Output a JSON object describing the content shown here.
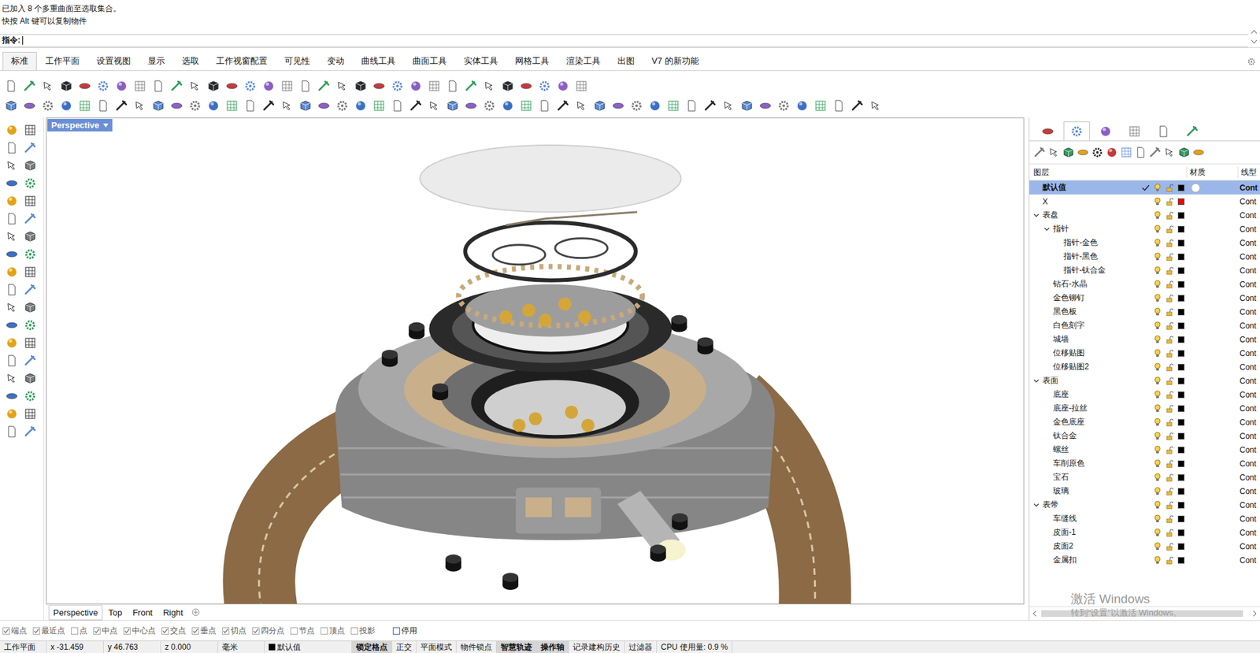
{
  "command": {
    "history": [
      "已加入 8 个多重曲面至选取集合。",
      "快按 Alt 键可以复制物件"
    ],
    "prompt": "指令:"
  },
  "menu_tabs": [
    {
      "label": "标准",
      "selected": true
    },
    {
      "label": "工作平面",
      "selected": false
    },
    {
      "label": "设置视图",
      "selected": false
    },
    {
      "label": "显示",
      "selected": false
    },
    {
      "label": "选取",
      "selected": false
    },
    {
      "label": "工作视窗配置",
      "selected": false
    },
    {
      "label": "可见性",
      "selected": false
    },
    {
      "label": "变动",
      "selected": false
    },
    {
      "label": "曲线工具",
      "selected": false
    },
    {
      "label": "曲面工具",
      "selected": false
    },
    {
      "label": "实体工具",
      "selected": false
    },
    {
      "label": "网格工具",
      "selected": false
    },
    {
      "label": "渲染工具",
      "selected": false
    },
    {
      "label": "出图",
      "selected": false
    },
    {
      "label": "V7 的新功能",
      "selected": false
    }
  ],
  "viewport": {
    "title": "Perspective"
  },
  "viewport_tabs": [
    {
      "label": "Perspective",
      "selected": true
    },
    {
      "label": "Top",
      "selected": false
    },
    {
      "label": "Front",
      "selected": false
    },
    {
      "label": "Right",
      "selected": false
    }
  ],
  "panel_tabs": [
    {
      "selected": false
    },
    {
      "selected": true
    },
    {
      "selected": false
    },
    {
      "selected": false
    },
    {
      "selected": false
    },
    {
      "selected": false
    }
  ],
  "layer_panel": {
    "columns": [
      "图层",
      "材质",
      "线型"
    ],
    "layers": [
      {
        "name": "默认值",
        "depth": 0,
        "kind": "layer",
        "expanded": false,
        "selected": true,
        "current": true,
        "visible": true,
        "locked": false,
        "color": "#000000",
        "material_swatch": true,
        "linetype": "Cont"
      },
      {
        "name": "X",
        "depth": 0,
        "kind": "layer",
        "expanded": false,
        "selected": false,
        "current": false,
        "visible": true,
        "locked": false,
        "color": "#ff0000",
        "material_swatch": false,
        "linetype": "Cont"
      },
      {
        "name": "表盘",
        "depth": 0,
        "kind": "group",
        "expanded": true,
        "selected": false,
        "current": false,
        "visible": true,
        "locked": false,
        "color": "#000000",
        "material_swatch": false,
        "linetype": "Cont"
      },
      {
        "name": "指针",
        "depth": 1,
        "kind": "group",
        "expanded": true,
        "selected": false,
        "current": false,
        "visible": true,
        "locked": false,
        "color": "#000000",
        "material_swatch": false,
        "linetype": "Cont"
      },
      {
        "name": "指针-金色",
        "depth": 2,
        "kind": "layer",
        "expanded": false,
        "selected": false,
        "current": false,
        "visible": true,
        "locked": false,
        "color": "#000000",
        "material_swatch": false,
        "linetype": "Cont"
      },
      {
        "name": "指针-黑色",
        "depth": 2,
        "kind": "layer",
        "expanded": false,
        "selected": false,
        "current": false,
        "visible": true,
        "locked": false,
        "color": "#000000",
        "material_swatch": false,
        "linetype": "Cont"
      },
      {
        "name": "指针-钛合金",
        "depth": 2,
        "kind": "layer",
        "expanded": false,
        "selected": false,
        "current": false,
        "visible": true,
        "locked": false,
        "color": "#000000",
        "material_swatch": false,
        "linetype": "Cont"
      },
      {
        "name": "钻石-水晶",
        "depth": 1,
        "kind": "layer",
        "expanded": false,
        "selected": false,
        "current": false,
        "visible": true,
        "locked": false,
        "color": "#000000",
        "material_swatch": false,
        "linetype": "Cont"
      },
      {
        "name": "金色铆钉",
        "depth": 1,
        "kind": "layer",
        "expanded": false,
        "selected": false,
        "current": false,
        "visible": true,
        "locked": false,
        "color": "#000000",
        "material_swatch": false,
        "linetype": "Cont"
      },
      {
        "name": "黑色板",
        "depth": 1,
        "kind": "layer",
        "expanded": false,
        "selected": false,
        "current": false,
        "visible": true,
        "locked": false,
        "color": "#000000",
        "material_swatch": false,
        "linetype": "Cont"
      },
      {
        "name": "白色刻字",
        "depth": 1,
        "kind": "layer",
        "expanded": false,
        "selected": false,
        "current": false,
        "visible": true,
        "locked": false,
        "color": "#000000",
        "material_swatch": false,
        "linetype": "Cont"
      },
      {
        "name": "城墙",
        "depth": 1,
        "kind": "layer",
        "expanded": false,
        "selected": false,
        "current": false,
        "visible": true,
        "locked": false,
        "color": "#000000",
        "material_swatch": false,
        "linetype": "Cont"
      },
      {
        "name": "位移贴图",
        "depth": 1,
        "kind": "layer",
        "expanded": false,
        "selected": false,
        "current": false,
        "visible": true,
        "locked": false,
        "color": "#000000",
        "material_swatch": false,
        "linetype": "Cont"
      },
      {
        "name": "位移贴图2",
        "depth": 1,
        "kind": "layer",
        "expanded": false,
        "selected": false,
        "current": false,
        "visible": true,
        "locked": false,
        "color": "#000000",
        "material_swatch": false,
        "linetype": "Cont"
      },
      {
        "name": "表面",
        "depth": 0,
        "kind": "group",
        "expanded": true,
        "selected": false,
        "current": false,
        "visible": true,
        "locked": false,
        "color": "#000000",
        "material_swatch": false,
        "linetype": "Cont"
      },
      {
        "name": "底座",
        "depth": 1,
        "kind": "layer",
        "expanded": false,
        "selected": false,
        "current": false,
        "visible": true,
        "locked": false,
        "color": "#000000",
        "material_swatch": false,
        "linetype": "Cont"
      },
      {
        "name": "底座-拉丝",
        "depth": 1,
        "kind": "layer",
        "expanded": false,
        "selected": false,
        "current": false,
        "visible": true,
        "locked": false,
        "color": "#000000",
        "material_swatch": false,
        "linetype": "Cont"
      },
      {
        "name": "金色底座",
        "depth": 1,
        "kind": "layer",
        "expanded": false,
        "selected": false,
        "current": false,
        "visible": true,
        "locked": false,
        "color": "#000000",
        "material_swatch": false,
        "linetype": "Cont"
      },
      {
        "name": "钛合金",
        "depth": 1,
        "kind": "layer",
        "expanded": false,
        "selected": false,
        "current": false,
        "visible": true,
        "locked": false,
        "color": "#000000",
        "material_swatch": false,
        "linetype": "Cont"
      },
      {
        "name": "螺丝",
        "depth": 1,
        "kind": "layer",
        "expanded": false,
        "selected": false,
        "current": false,
        "visible": true,
        "locked": false,
        "color": "#000000",
        "material_swatch": false,
        "linetype": "Cont"
      },
      {
        "name": "车削原色",
        "depth": 1,
        "kind": "layer",
        "expanded": false,
        "selected": false,
        "current": false,
        "visible": true,
        "locked": false,
        "color": "#000000",
        "material_swatch": false,
        "linetype": "Cont"
      },
      {
        "name": "宝石",
        "depth": 1,
        "kind": "layer",
        "expanded": false,
        "selected": false,
        "current": false,
        "visible": true,
        "locked": false,
        "color": "#000000",
        "material_swatch": false,
        "linetype": "Cont"
      },
      {
        "name": "玻璃",
        "depth": 1,
        "kind": "layer",
        "expanded": false,
        "selected": false,
        "current": false,
        "visible": true,
        "locked": false,
        "color": "#000000",
        "material_swatch": false,
        "linetype": "Cont"
      },
      {
        "name": "表带",
        "depth": 0,
        "kind": "group",
        "expanded": true,
        "selected": false,
        "current": false,
        "visible": true,
        "locked": false,
        "color": "#000000",
        "material_swatch": false,
        "linetype": "Cont"
      },
      {
        "name": "车缝线",
        "depth": 1,
        "kind": "layer",
        "expanded": false,
        "selected": false,
        "current": false,
        "visible": true,
        "locked": false,
        "color": "#000000",
        "material_swatch": false,
        "linetype": "Cont"
      },
      {
        "name": "皮面-1",
        "depth": 1,
        "kind": "layer",
        "expanded": false,
        "selected": false,
        "current": false,
        "visible": true,
        "locked": false,
        "color": "#000000",
        "material_swatch": false,
        "linetype": "Cont"
      },
      {
        "name": "皮面2",
        "depth": 1,
        "kind": "layer",
        "expanded": false,
        "selected": false,
        "current": false,
        "visible": true,
        "locked": false,
        "color": "#000000",
        "material_swatch": false,
        "linetype": "Cont"
      },
      {
        "name": "金属扣",
        "depth": 1,
        "kind": "layer",
        "expanded": false,
        "selected": false,
        "current": false,
        "visible": true,
        "locked": false,
        "color": "#000000",
        "material_swatch": false,
        "linetype": "Cont"
      }
    ]
  },
  "watermark": {
    "title": "激活 Windows",
    "subtitle": "转到“设置”以激活 Windows。"
  },
  "osnaps": [
    {
      "label": "端点",
      "checked": true
    },
    {
      "label": "最近点",
      "checked": true
    },
    {
      "label": "点",
      "checked": false
    },
    {
      "label": "中点",
      "checked": true
    },
    {
      "label": "中心点",
      "checked": true
    },
    {
      "label": "交点",
      "checked": true
    },
    {
      "label": "垂点",
      "checked": true
    },
    {
      "label": "切点",
      "checked": true
    },
    {
      "label": "四分点",
      "checked": true
    },
    {
      "label": "节点",
      "checked": false
    },
    {
      "label": "顶点",
      "checked": false
    },
    {
      "label": "投影",
      "checked": false
    }
  ],
  "osnap_disable": {
    "label": "停用",
    "checked": false
  },
  "status_bar": {
    "cplane": "工作平面",
    "x": "x -31.459",
    "y": "y 46.763",
    "z": "z 0.000",
    "units": "毫米",
    "layer": "默认值",
    "layer_color": "#000000",
    "toggles": [
      {
        "label": "锁定格点",
        "on": true
      },
      {
        "label": "正交",
        "on": false
      },
      {
        "label": "平面模式",
        "on": false
      },
      {
        "label": "物件锁点",
        "on": false
      },
      {
        "label": "智慧轨迹",
        "on": true
      },
      {
        "label": "操作轴",
        "on": true
      },
      {
        "label": "记录建构历史",
        "on": false
      },
      {
        "label": "过滤器",
        "on": false
      }
    ],
    "cpu": "CPU 使用量: 0.9 %"
  }
}
